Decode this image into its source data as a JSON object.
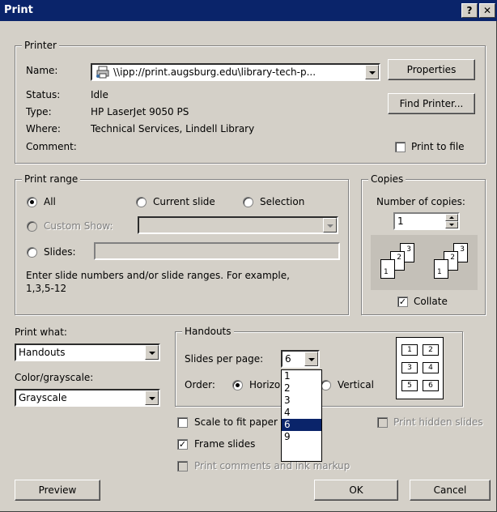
{
  "window": {
    "title": "Print",
    "help_btn": "?",
    "close_btn": "✕"
  },
  "printer": {
    "legend": "Printer",
    "name_label": "Name:",
    "name_value": "\\\\ipp://print.augsburg.edu\\library-tech-p...",
    "status_label": "Status:",
    "status_value": "Idle",
    "type_label": "Type:",
    "type_value": "HP LaserJet 9050 PS",
    "where_label": "Where:",
    "where_value": "Technical Services, Lindell Library",
    "comment_label": "Comment:",
    "properties_btn": "Properties",
    "find_printer_btn": "Find Printer...",
    "print_to_file": "Print to file"
  },
  "print_range": {
    "legend": "Print range",
    "all": "All",
    "current_slide": "Current slide",
    "selection": "Selection",
    "custom_show": "Custom Show:",
    "slides": "Slides:",
    "hint": "Enter slide numbers and/or slide ranges. For example,",
    "hint2": "1,3,5-12"
  },
  "copies": {
    "legend": "Copies",
    "number_label": "Number of copies:",
    "value": "1",
    "collate": "Collate",
    "icons": [
      "1",
      "2",
      "3"
    ]
  },
  "print_what": {
    "label": "Print what:",
    "value": "Handouts"
  },
  "color": {
    "label": "Color/grayscale:",
    "value": "Grayscale"
  },
  "handouts": {
    "legend": "Handouts",
    "slides_per_page_label": "Slides per page:",
    "slides_per_page_value": "6",
    "order_label": "Order:",
    "horizontal": "Horizontal",
    "vertical": "Vertical",
    "options": [
      "1",
      "2",
      "3",
      "4",
      "6",
      "9"
    ],
    "preview_nums": [
      "1",
      "2",
      "3",
      "4",
      "5",
      "6"
    ]
  },
  "options": {
    "scale_to_fit": "Scale to fit paper",
    "frame_slides": "Frame slides",
    "print_comments": "Print comments and ink markup",
    "print_hidden": "Print hidden slides"
  },
  "buttons": {
    "preview": "Preview",
    "ok": "OK",
    "cancel": "Cancel"
  }
}
